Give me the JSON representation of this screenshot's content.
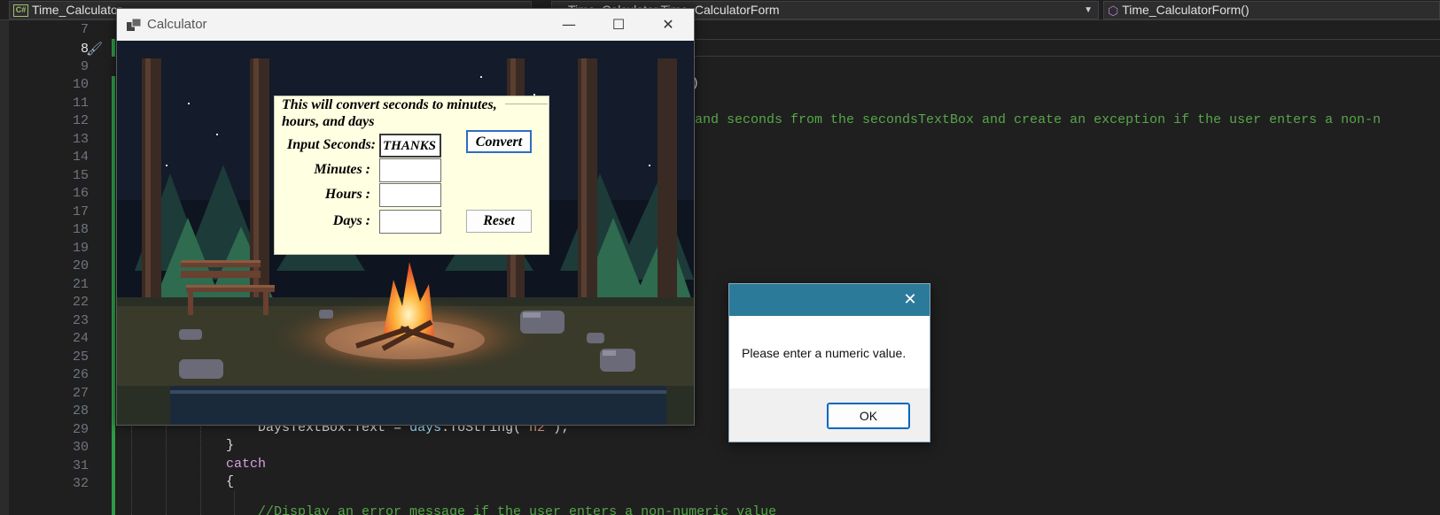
{
  "ide": {
    "project_name": "Time_Calculator",
    "class_path": "Time_Calculator.Time_CalculatorForm",
    "member": "Time_CalculatorForm()",
    "line_numbers": [
      "7",
      "8",
      "9",
      "10",
      "11",
      "12",
      "13",
      "14",
      "15",
      "16",
      "17",
      "18",
      "19",
      "20",
      "21",
      "22",
      "23",
      "24",
      "25",
      "26",
      "27",
      "28",
      "29",
      "30",
      "31",
      "32"
    ],
    "current_line": "8",
    "code_line_10_fragment": ")",
    "code_comment_fragment": "and seconds from the secondsTextBox and create an exception if the user enters a non-n",
    "code_line_29": {
      "target": "DaysTextBox",
      "dot1": ".",
      "prop": "Text",
      "eq": " = ",
      "var": "days",
      "dot2": ".",
      "method": "ToString(",
      "arg": "\"n2\"",
      "end": ");"
    },
    "code_line_30": "}",
    "code_line_31": "catch",
    "code_line_32": "{",
    "code_line_33_partial": "//Display an error message if the user enters a non-numeric value"
  },
  "calculator": {
    "title": "Calculator",
    "window_buttons": {
      "minimize": "—",
      "maximize": "☐",
      "close": "✕"
    },
    "description": "This will convert seconds to minutes, hours, and days",
    "labels": {
      "seconds": "Input Seconds:",
      "minutes": "Minutes :",
      "hours": "Hours :",
      "days": "Days :"
    },
    "inputs": {
      "seconds": "THANKS",
      "minutes": "",
      "hours": "",
      "days": ""
    },
    "buttons": {
      "convert": "Convert",
      "reset": "Reset"
    }
  },
  "message_box": {
    "close": "✕",
    "text": "Please enter a numeric value.",
    "ok_label": "OK"
  },
  "colors": {
    "ide_bg": "#1f1f1f",
    "form_panel": "#ffffe1",
    "msg_titlebar": "#2c7a9a",
    "comment": "#57a64a",
    "keyword": "#d8a0df"
  }
}
